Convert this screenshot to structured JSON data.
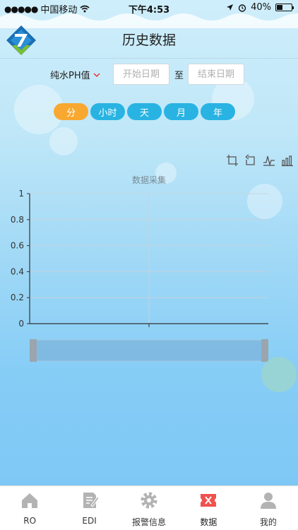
{
  "status_bar": {
    "carrier": "中国移动",
    "time": "下午4:53",
    "battery": "40%",
    "battery_level": 0.4
  },
  "header": {
    "title": "历史数据"
  },
  "filter": {
    "parameter": "纯水PH值",
    "start_placeholder": "开始日期",
    "to_label": "至",
    "end_placeholder": "结束日期"
  },
  "periods": [
    {
      "label": "分",
      "active": true
    },
    {
      "label": "小时",
      "active": false
    },
    {
      "label": "天",
      "active": false
    },
    {
      "label": "月",
      "active": false
    },
    {
      "label": "年",
      "active": false
    }
  ],
  "toolbox": [
    "crop-icon",
    "undo-icon",
    "line-chart-icon",
    "bar-chart-icon"
  ],
  "chart_data": {
    "type": "line",
    "title": "数据采集",
    "x": [],
    "series": [],
    "yticks": [
      "0",
      "0.2",
      "0.4",
      "0.6",
      "0.8",
      "1"
    ],
    "ylim": [
      0,
      1
    ],
    "grid": true
  },
  "tabbar": [
    {
      "label": "RO",
      "icon": "home-icon",
      "active": false
    },
    {
      "label": "EDI",
      "icon": "edit-icon",
      "active": false
    },
    {
      "label": "报警信息",
      "icon": "gear-icon",
      "active": false
    },
    {
      "label": "数据",
      "icon": "ticket-icon",
      "active": true
    },
    {
      "label": "我的",
      "icon": "person-icon",
      "active": false
    }
  ],
  "colors": {
    "accent": "#29b3e2",
    "active_pill": "#f8a830",
    "active_tab": "#f0524f"
  }
}
